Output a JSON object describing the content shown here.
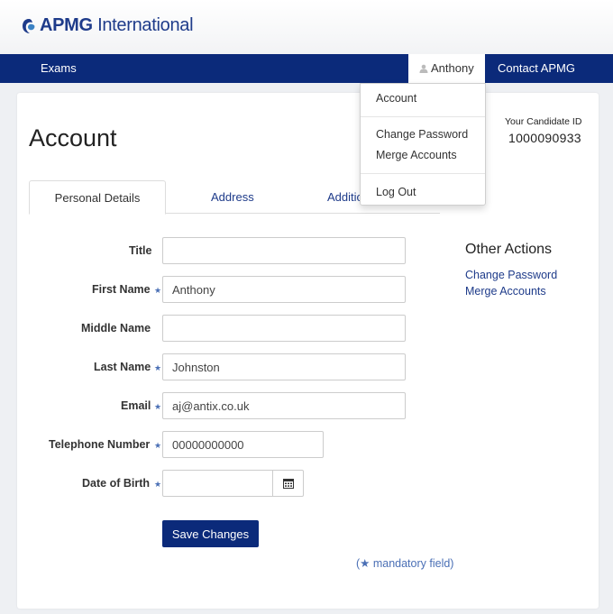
{
  "brand": {
    "name_bold": "APMG",
    "name_rest": " International",
    "logo_icon": "apmg-swirl-icon",
    "color": "#1e3b8a"
  },
  "nav": {
    "exams": "Exams",
    "user": "Anthony",
    "contact": "Contact APMG",
    "user_icon": "user-icon"
  },
  "user_menu": {
    "account": "Account",
    "change_password": "Change Password",
    "merge_accounts": "Merge Accounts",
    "log_out": "Log Out"
  },
  "page": {
    "title": "Account",
    "candidate_label": "Your Candidate ID",
    "candidate_id": "1000090933"
  },
  "tabs": {
    "personal": "Personal Details",
    "address": "Address",
    "additional": "Additio"
  },
  "form": {
    "title": {
      "label": "Title",
      "value": ""
    },
    "first_name": {
      "label": "First Name",
      "value": "Anthony",
      "required": "★"
    },
    "middle_name": {
      "label": "Middle Name",
      "value": ""
    },
    "last_name": {
      "label": "Last Name",
      "value": "Johnston",
      "required": "★"
    },
    "email": {
      "label": "Email",
      "value": "aj@antix.co.uk",
      "required": "★"
    },
    "telephone": {
      "label": "Telephone Number",
      "value": "00000000000",
      "required": "★"
    },
    "dob": {
      "label": "Date of Birth",
      "value": "",
      "required": "★",
      "icon": "calendar-icon"
    },
    "save": "Save Changes",
    "mandatory_note": "(★ mandatory field)"
  },
  "other_actions": {
    "title": "Other Actions",
    "change_password": "Change Password",
    "merge_accounts": "Merge Accounts"
  },
  "colors": {
    "navbar": "#0b2a7a",
    "link": "#1e3b8a",
    "required_star": "#4a6fb5"
  }
}
